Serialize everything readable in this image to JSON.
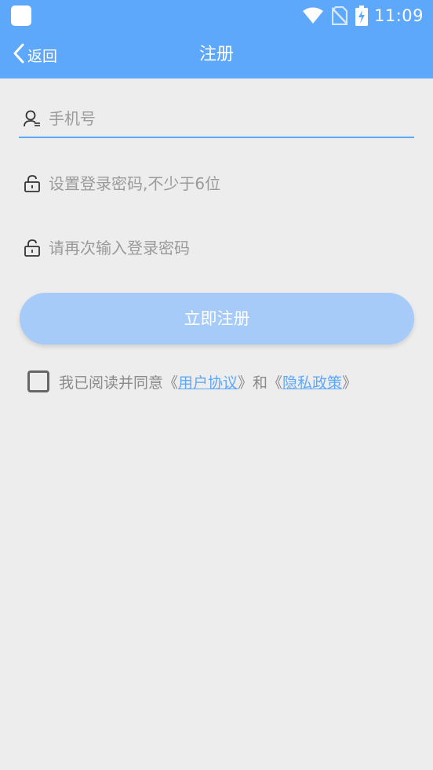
{
  "status_bar": {
    "time": "11:09",
    "icons": [
      "app-notification-icon",
      "wifi-icon",
      "no-sim-icon",
      "battery-charging-icon"
    ]
  },
  "nav": {
    "back_label": "返回",
    "title": "注册"
  },
  "form": {
    "phone": {
      "placeholder": "手机号",
      "value": ""
    },
    "password": {
      "placeholder": "设置登录密码,不少于6位",
      "value": ""
    },
    "confirm_password": {
      "placeholder": "请再次输入登录密码",
      "value": ""
    },
    "submit_label": "立即注册"
  },
  "agreement": {
    "checked": false,
    "prefix": "我已阅读并同意《",
    "user_agreement": "用户协议",
    "middle": "》和《",
    "privacy_policy": "隐私政策",
    "suffix": "》"
  },
  "colors": {
    "accent": "#5ea8fb",
    "button_disabled": "#a6cbf8",
    "background": "#ededed",
    "placeholder": "#9a9a9a"
  }
}
